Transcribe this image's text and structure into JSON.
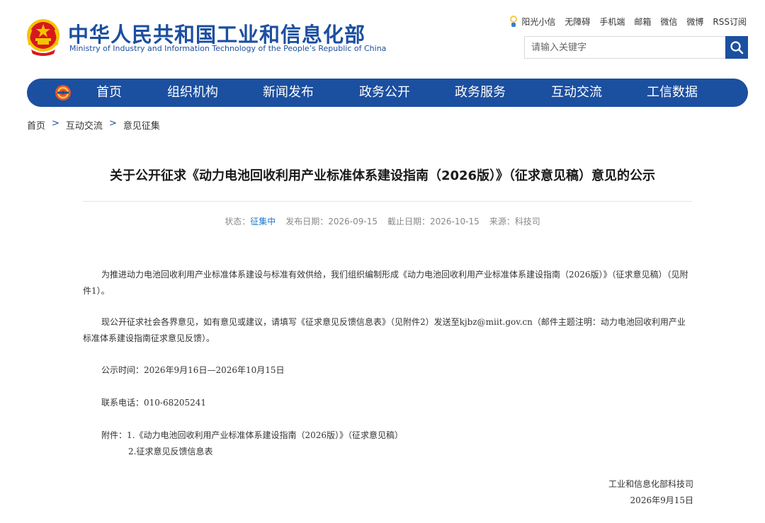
{
  "header": {
    "site_name_cn": "中华人民共和国工业和信息化部",
    "site_name_en": "Ministry of Industry and Information Technology of the People’s Republic of China",
    "emblem_icon": "national-emblem-icon",
    "top_links": [
      "阳光小信",
      "无障碍",
      "手机端",
      "邮箱",
      "微信",
      "微博",
      "RSS订阅"
    ],
    "search": {
      "placeholder": "请输入关键字",
      "icon": "search-icon"
    }
  },
  "nav": {
    "logo_icon": "miit-logo-icon",
    "items": [
      "首页",
      "组织机构",
      "新闻发布",
      "政务公开",
      "政务服务",
      "互动交流",
      "工信数据"
    ]
  },
  "breadcrumb": {
    "items": [
      "首页",
      "互动交流",
      "意见征集"
    ],
    "separator": ">"
  },
  "article": {
    "title": "关于公开征求《动力电池回收利用产业标准体系建设指南（2026版）》（征求意见稿）意见的公示",
    "meta": {
      "status_label": "状态：",
      "status_value": "征集中",
      "publish_label": "发布日期：",
      "publish_date": "2026-09-15",
      "deadline_label": "截止日期：",
      "deadline_date": "2026-10-15",
      "source_label": "来源：",
      "source_value": "科技司"
    },
    "paragraphs": [
      "为推进动力电池回收利用产业标准体系建设与标准有效供给，我们组织编制形成《动力电池回收利用产业标准体系建设指南（2026版）》（征求意见稿）（见附件1）。",
      "现公开征求社会各界意见，如有意见或建议，请填写《征求意见反馈信息表》（见附件2）发送至kjbz@miit.gov.cn（邮件主题注明：动力电池回收利用产业标准体系建设指南征求意见反馈）。"
    ],
    "notice_period": "公示时间：2026年9月16日—2026年10月15日",
    "contact_phone": "联系电话：010-68205241",
    "attachment_1": "附件：1.《动力电池回收利用产业标准体系建设指南（2026版）》（征求意见稿）",
    "attachment_2": "2.征求意见反馈信息表",
    "signature_org": "工业和信息化部科技司",
    "signature_date": "2026年9月15日"
  },
  "colors": {
    "brand_blue": "#1b4fa0",
    "status_blue": "#1b78d0",
    "emblem_red": "#d7191c",
    "emblem_gold": "#f5c400"
  }
}
